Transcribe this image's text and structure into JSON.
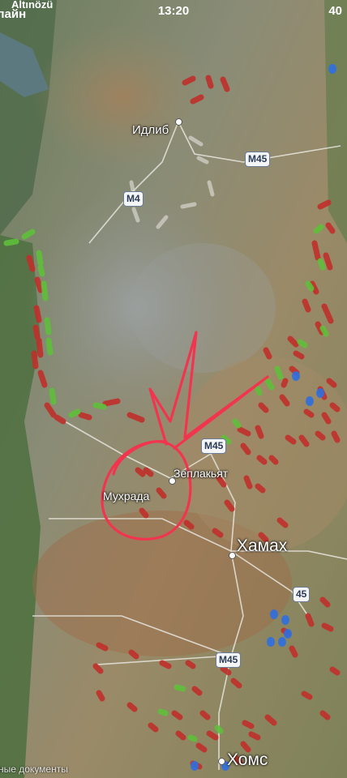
{
  "status_bar": {
    "carrier_top": "Altınözü",
    "carrier": "лайн",
    "time": "13:20",
    "battery": "40"
  },
  "map": {
    "cities": [
      {
        "name": "Идлиб",
        "size": "small"
      },
      {
        "name": "Зеплакьят",
        "size": "medium"
      },
      {
        "name": "Мухрада",
        "size": "medium"
      },
      {
        "name": "Хамах",
        "size": "large"
      },
      {
        "name": "Хомс",
        "size": "large"
      }
    ],
    "road_shields": [
      {
        "label": "M45",
        "id": "m45-north"
      },
      {
        "label": "M4",
        "id": "m4"
      },
      {
        "label": "M45",
        "id": "m45-mid"
      },
      {
        "label": "45",
        "id": "45"
      },
      {
        "label": "M45",
        "id": "m45-south"
      }
    ],
    "footer_text": "ные документы",
    "colors": {
      "frontline_red": "#c0302b",
      "frontline_green": "#5fbf3a",
      "annotation_pink": "#f2354f",
      "marker_blue": "#2f6fe0"
    }
  }
}
